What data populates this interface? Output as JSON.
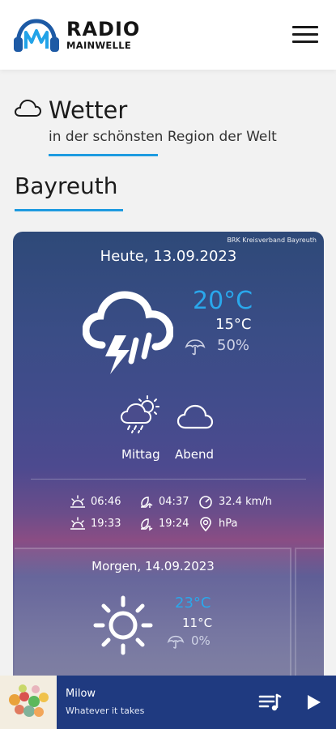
{
  "header": {
    "logo_line1": "RADIO",
    "logo_line2": "MAINWELLE",
    "menu_icon": "hamburger-icon",
    "brand_color": "#1e9be0"
  },
  "section": {
    "title": "Wetter",
    "subtitle": "in der schönsten Region der Welt",
    "icon": "cloud-outline-icon"
  },
  "location": {
    "city": "Bayreuth"
  },
  "today": {
    "credit": "BRK Kreisverband Bayreuth",
    "date": "Heute, 13.09.2023",
    "icon": "thunderstorm-icon",
    "temp_high": "20°C",
    "temp_low": "15°C",
    "rain_chance": "50%",
    "parts": [
      {
        "label": "Mittag",
        "icon": "sun-cloud-rain-icon"
      },
      {
        "label": "Abend",
        "icon": "cloud-icon"
      }
    ],
    "stats": {
      "sunrise": "06:46",
      "moonrise": "04:37",
      "wind": "32.4 km/h",
      "sunset": "19:33",
      "moonset": "19:24",
      "pressure": "hPa"
    }
  },
  "tomorrow": {
    "date": "Morgen, 14.09.2023",
    "icon": "sun-icon",
    "temp_high": "23°C",
    "temp_low": "11°C",
    "rain_chance": "0%"
  },
  "player": {
    "artist": "Milow",
    "title": "Whatever it takes",
    "queue_icon": "playlist-icon",
    "play_icon": "play-icon"
  },
  "colors": {
    "accent": "#1e9be0",
    "temp_high": "#2aa8ec",
    "player_bg": "#1f3a80"
  }
}
